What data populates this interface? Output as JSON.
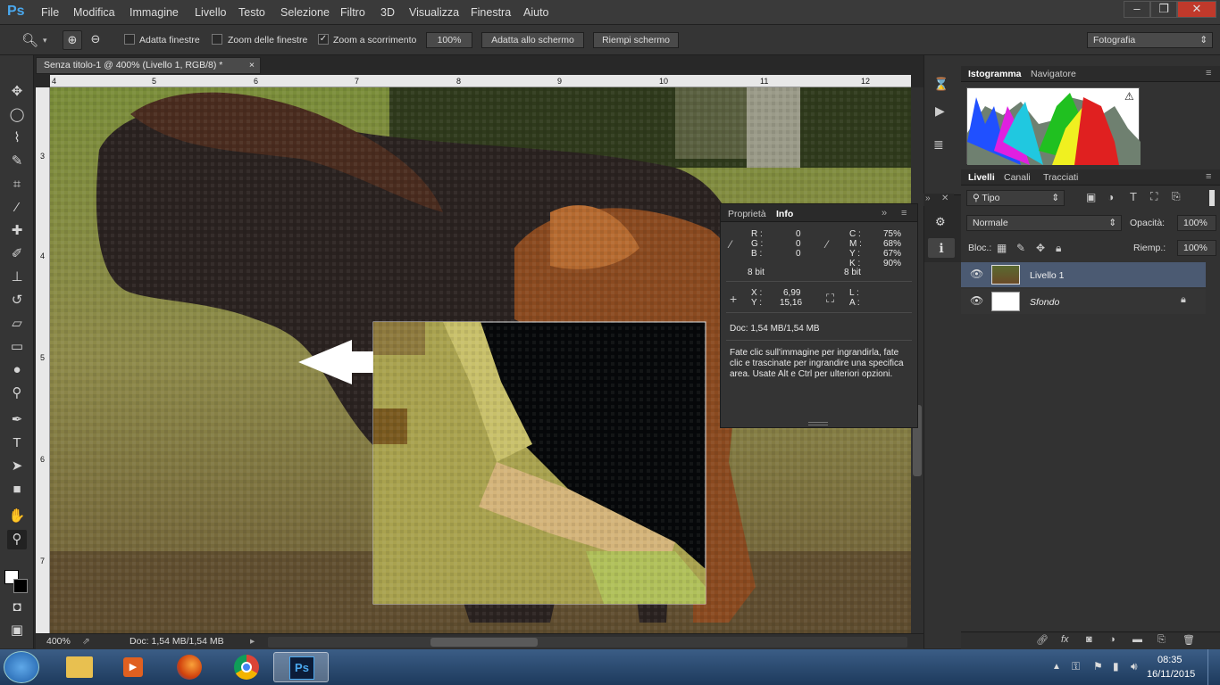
{
  "app": {
    "logo": "Ps"
  },
  "menu": [
    "File",
    "Modifica",
    "Immagine",
    "Livello",
    "Testo",
    "Selezione",
    "Filtro",
    "3D",
    "Visualizza",
    "Finestra",
    "Aiuto"
  ],
  "window_buttons": [
    "–",
    "❐",
    "✕"
  ],
  "options": {
    "chk1": "Adatta finestre",
    "chk2": "Zoom delle finestre",
    "chk3": "Zoom a scorrimento",
    "zoom_value": "100%",
    "fit_screen": "Adatta allo schermo",
    "fill_screen": "Riempi schermo",
    "workspace": "Fotografia"
  },
  "document": {
    "tab_title": "Senza titolo-1 @ 400% (Livello 1, RGB/8) *",
    "ruler_top": [
      "4",
      "5",
      "6",
      "7",
      "8",
      "9",
      "10",
      "11",
      "12"
    ],
    "ruler_left": [
      "3",
      "4",
      "5",
      "6",
      "7"
    ]
  },
  "status": {
    "zoom": "400%",
    "doc": "Doc: 1,54 MB/1,54 MB"
  },
  "top_panel": {
    "tabs": [
      "Istogramma",
      "Navigatore"
    ]
  },
  "layers_panel": {
    "tabs": [
      "Livelli",
      "Canali",
      "Tracciati"
    ],
    "filter": "Tipo",
    "blend": "Normale",
    "opacity_label": "Opacità:",
    "opacity": "100%",
    "lock_label": "Bloc.:",
    "fill_label": "Riemp.:",
    "fill": "100%",
    "layers": [
      {
        "name": "Livello 1",
        "italic": false,
        "selected": true
      },
      {
        "name": "Sfondo",
        "italic": true,
        "selected": false
      }
    ]
  },
  "info_panel": {
    "tabs": [
      "Proprietà",
      "Info"
    ],
    "rgb": {
      "labels": [
        "R :",
        "G :",
        "B :"
      ],
      "values": [
        "0",
        "0",
        "0"
      ],
      "bit": "8 bit"
    },
    "cmyk": {
      "labels": [
        "C :",
        "M :",
        "Y :",
        "K :"
      ],
      "values": [
        "75%",
        "68%",
        "67%",
        "90%"
      ],
      "bit": "8 bit"
    },
    "xy": {
      "labels": [
        "X :",
        "Y :"
      ],
      "values": [
        "6,99",
        "15,16"
      ]
    },
    "wh": {
      "labels": [
        "L :",
        "A :"
      ]
    },
    "doc": "Doc: 1,54 MB/1,54 MB",
    "help": "Fate clic sull'immagine per ingrandirla, fate clic e trascinate per ingrandire una specifica area. Usate Alt e Ctrl per ulteriori opzioni."
  },
  "taskbar": {
    "time": "08:35",
    "date": "16/11/2015"
  }
}
